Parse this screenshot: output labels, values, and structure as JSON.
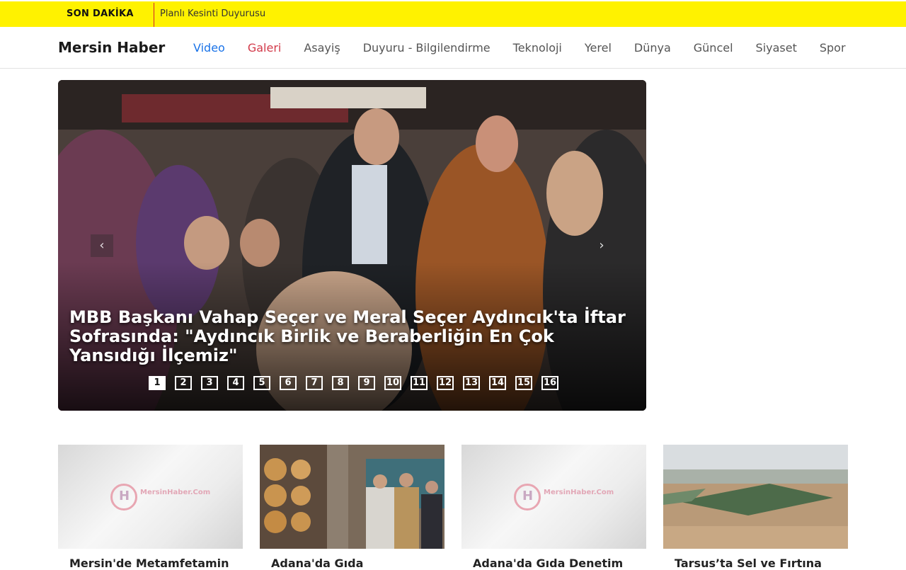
{
  "breaking": {
    "label": "SON DAKİKA",
    "text": "Planlı Kesinti Duyurusu"
  },
  "header": {
    "brand": "Mersin Haber",
    "nav": [
      "Video",
      "Galeri",
      "Asayiş",
      "Duyuru - Bilgilendirme",
      "Teknoloji",
      "Yerel",
      "Dünya",
      "Güncel",
      "Siyaset",
      "Spor"
    ]
  },
  "hero": {
    "title": "MBB Başkanı Vahap Seçer ve Meral Seçer Aydıncık'ta İftar Sofrasında: \"Aydıncık Birlik ve Beraberliğin En Çok Yansıdığı İlçemiz\"",
    "prev_icon": "chevron-left-icon",
    "next_icon": "chevron-right-icon",
    "pages": [
      "1",
      "2",
      "3",
      "4",
      "5",
      "6",
      "7",
      "8",
      "9",
      "10",
      "11",
      "12",
      "13",
      "14",
      "15",
      "16"
    ],
    "active_page": "1"
  },
  "cards": [
    {
      "title": "Mersin'de Metamfetamin",
      "image": "placeholder-logo",
      "logo_text": "MersinHaber.Com"
    },
    {
      "title": "Adana'da Gıda",
      "image": "bakery-photo"
    },
    {
      "title": "Adana'da Gıda Denetim",
      "image": "placeholder-logo",
      "logo_text": "MersinHaber.Com"
    },
    {
      "title": "Tarsus’ta Sel ve Fırtına",
      "image": "flood-aerial-photo"
    }
  ],
  "colors": {
    "breaking_bg": "#fff200",
    "breaking_separator": "#d2232a",
    "nav_video": "#1a73e8",
    "nav_galeri": "#d23a4a"
  }
}
